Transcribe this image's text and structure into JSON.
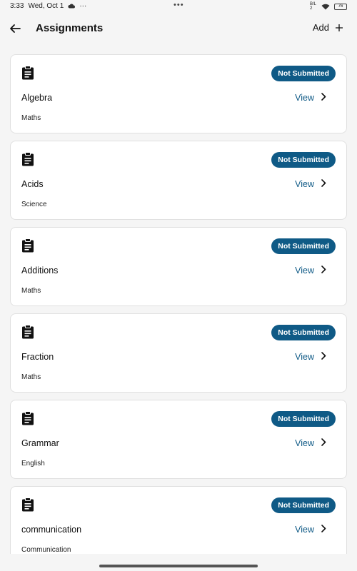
{
  "status_bar": {
    "time": "3:33",
    "date": "Wed, Oct 1",
    "dots": "•••",
    "signal": "B/L 2",
    "battery": "76"
  },
  "header": {
    "title": "Assignments",
    "add_label": "Add"
  },
  "assignments": [
    {
      "title": "Algebra",
      "subject": "Maths",
      "status": "Not Submitted",
      "action": "View"
    },
    {
      "title": "Acids",
      "subject": "Science",
      "status": "Not Submitted",
      "action": "View"
    },
    {
      "title": "Additions",
      "subject": "Maths",
      "status": "Not Submitted",
      "action": "View"
    },
    {
      "title": "Fraction",
      "subject": "Maths",
      "status": "Not Submitted",
      "action": "View"
    },
    {
      "title": "Grammar",
      "subject": "English",
      "status": "Not Submitted",
      "action": "View"
    },
    {
      "title": "communication",
      "subject": "Communication",
      "status": "Not Submitted",
      "action": "View"
    }
  ],
  "colors": {
    "accent": "#0f5a86",
    "background": "#f5f5f5",
    "card": "#ffffff"
  },
  "icons": {
    "back": "arrow-left-icon",
    "add": "plus-icon",
    "assignment": "clipboard-icon",
    "view": "chevron-right-icon"
  }
}
